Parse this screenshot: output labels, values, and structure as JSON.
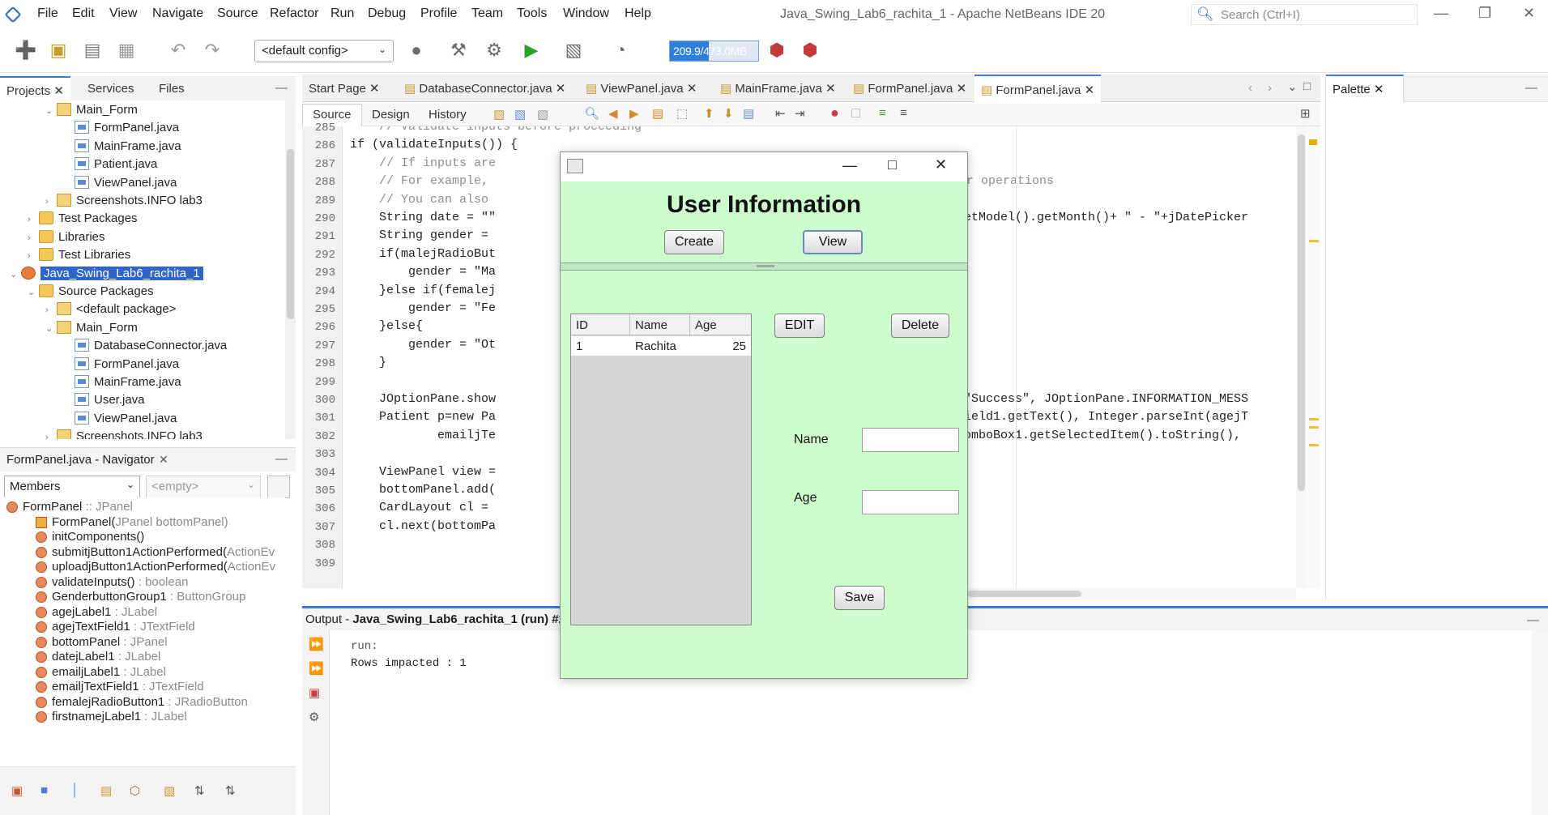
{
  "app": {
    "menu": [
      "File",
      "Edit",
      "View",
      "Navigate",
      "Source",
      "Refactor",
      "Run",
      "Debug",
      "Profile",
      "Team",
      "Tools",
      "Window",
      "Help"
    ],
    "title": "Java_Swing_Lab6_rachita_1 - Apache NetBeans IDE 20",
    "search_placeholder": "Search (Ctrl+I)"
  },
  "toolbar": {
    "config": "<default config>",
    "memory": "209.9/473.0MB",
    "memory_fraction": 0.44
  },
  "projects_panel": {
    "tabs": [
      "Projects",
      "Services",
      "Files"
    ],
    "tree": [
      {
        "label": "Main_Form",
        "icon": "package",
        "indent": 2,
        "twisty": "v"
      },
      {
        "label": "FormPanel.java",
        "icon": "java",
        "indent": 3
      },
      {
        "label": "MainFrame.java",
        "icon": "java",
        "indent": 3
      },
      {
        "label": "Patient.java",
        "icon": "java",
        "indent": 3
      },
      {
        "label": "ViewPanel.java",
        "icon": "java",
        "indent": 3
      },
      {
        "label": "Screenshots.INFO lab3",
        "icon": "package",
        "indent": 2,
        "twisty": ">"
      },
      {
        "label": "Test Packages",
        "icon": "folder",
        "indent": 1,
        "twisty": ">"
      },
      {
        "label": "Libraries",
        "icon": "folder",
        "indent": 1,
        "twisty": ">"
      },
      {
        "label": "Test Libraries",
        "icon": "folder",
        "indent": 1,
        "twisty": ">"
      },
      {
        "label": "Java_Swing_Lab6_rachita_1",
        "icon": "project",
        "indent": 0,
        "twisty": "v",
        "selected": true
      },
      {
        "label": "Source Packages",
        "icon": "folder",
        "indent": 1,
        "twisty": "v"
      },
      {
        "label": "<default package>",
        "icon": "package",
        "indent": 2,
        "twisty": ">"
      },
      {
        "label": "Main_Form",
        "icon": "package",
        "indent": 2,
        "twisty": "v"
      },
      {
        "label": "DatabaseConnector.java",
        "icon": "java",
        "indent": 3
      },
      {
        "label": "FormPanel.java",
        "icon": "java",
        "indent": 3
      },
      {
        "label": "MainFrame.java",
        "icon": "java",
        "indent": 3
      },
      {
        "label": "User.java",
        "icon": "java",
        "indent": 3
      },
      {
        "label": "ViewPanel.java",
        "icon": "java",
        "indent": 3
      },
      {
        "label": "Screenshots.INFO lab3",
        "icon": "package",
        "indent": 2,
        "twisty": ">"
      }
    ]
  },
  "navigator": {
    "title": "FormPanel.java - Navigator",
    "filter": "Members",
    "filter2": "<empty>",
    "items": [
      {
        "name": "FormPanel",
        "type": " :: JPanel"
      },
      {
        "name": "FormPanel(",
        "type": "JPanel bottomPanel)"
      },
      {
        "name": "initComponents()",
        "type": ""
      },
      {
        "name": "submitjButton1ActionPerformed(",
        "type": "ActionEv"
      },
      {
        "name": "uploadjButton1ActionPerformed(",
        "type": "ActionEv"
      },
      {
        "name": "validateInputs()",
        "type": " : boolean"
      },
      {
        "name": "GenderbuttonGroup1",
        "type": " : ButtonGroup"
      },
      {
        "name": "agejLabel1",
        "type": " : JLabel"
      },
      {
        "name": "agejTextField1",
        "type": " : JTextField"
      },
      {
        "name": "bottomPanel",
        "type": " : JPanel"
      },
      {
        "name": "datejLabel1",
        "type": " : JLabel"
      },
      {
        "name": "emailjLabel1",
        "type": " : JLabel"
      },
      {
        "name": "emailjTextField1",
        "type": " : JTextField"
      },
      {
        "name": "femalejRadioButton1",
        "type": " : JRadioButton"
      },
      {
        "name": "firstnamejLabel1",
        "type": " : JLabel"
      }
    ]
  },
  "editor": {
    "tabs": [
      "Start Page",
      "DatabaseConnector.java",
      "ViewPanel.java",
      "MainFrame.java",
      "FormPanel.java",
      "FormPanel.java"
    ],
    "subtabs": [
      "Source",
      "Design",
      "History"
    ],
    "line_numbers": [
      "285",
      "286",
      "287",
      "288",
      "289",
      "290",
      "291",
      "292",
      "293",
      "294",
      "295",
      "296",
      "297",
      "298",
      "299",
      "300",
      "301",
      "302",
      "303",
      "304",
      "305",
      "306",
      "307",
      "308",
      "309"
    ],
    "left_code": [
      "    // Validate inputs before proceeding",
      "if (validateInputs()) {",
      "    // If inputs are",
      "    // For example,",
      "    // You can also",
      "    String date = \"\"",
      "    String gender =",
      "    if(malejRadioBut",
      "        gender = \"Ma",
      "    }else if(femalej",
      "        gender = \"Fe",
      "    }else{",
      "        gender = \"Ot",
      "    }",
      "",
      "    JOptionPane.show",
      "    Patient p=new Pa",
      "            emailjTe",
      "",
      "    ViewPanel view =",
      "    bottomPanel.add(",
      "    CardLayout cl =",
      "    cl.next(bottomPa",
      "",
      ""
    ],
    "right_code": {
      "288": "er operations",
      "290": ".getModel().getMonth()+ \" - \"+jDatePicker",
      "300": ", \"Success\", JOptionPane.INFORMATION_MESS",
      "301": "tField1.getText(), Integer.parseInt(agejT",
      "302": "jComboBox1.getSelectedItem().toString(),"
    }
  },
  "palette": {
    "title": "Palette"
  },
  "output": {
    "title_prefix": "Output - ",
    "title": "Java_Swing_Lab6_rachita_1 (run) #2",
    "lines": [
      "run:",
      "Rows impacted : 1"
    ]
  },
  "dialog": {
    "heading": "User Information",
    "create_label": "Create",
    "view_label": "View",
    "edit_label": "EDIT",
    "delete_label": "Delete",
    "save_label": "Save",
    "name_label": "Name",
    "age_label": "Age",
    "table": {
      "columns": [
        "ID",
        "Name",
        "Age"
      ],
      "rows": [
        [
          "1",
          "Rachita",
          "25"
        ]
      ]
    }
  }
}
